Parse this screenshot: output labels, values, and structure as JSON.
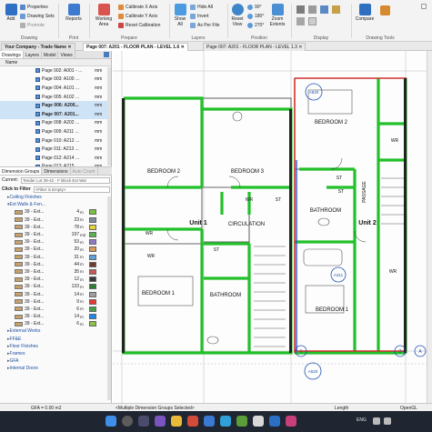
{
  "ribbon": {
    "drawing": {
      "add": "Add",
      "properties": "Properties",
      "drawing_sets": "Drawing Sets",
      "promote": "Promote",
      "label": "Drawing"
    },
    "print": {
      "reports": "Reports",
      "label": "Print"
    },
    "prepare": {
      "working_area": "Working Area",
      "calibrate_x": "Calibrate X Axis",
      "calibrate_y": "Calibrate Y Axis",
      "reset_calibration": "Reset Calibration",
      "label": "Prepare"
    },
    "layers": {
      "show_all": "Show All",
      "hide_all": "Hide All",
      "invert": "Invert",
      "as_per_file": "As Per File",
      "label": "Layers"
    },
    "position": {
      "reset_view": "Reset View",
      "rot90": "90°",
      "rot180": "180°",
      "rot270": "270°",
      "zoom_extents": "Zoom Extents",
      "label": "Position"
    },
    "display": {
      "label": "Display"
    },
    "drawing_tools": {
      "compare": "Compare",
      "label": "Drawing Tools"
    }
  },
  "tabs": {
    "company": "Your Company - Trade Name",
    "doc1": "Page 007: A201 - FLOOR PLAN - LEVEL 1.6",
    "doc2": "Page 007: A201 - FLOOR PLAN - LEVEL 1.3"
  },
  "left": {
    "tabs": [
      "Drawings",
      "Layers",
      "Model",
      "Views"
    ],
    "col_name": "Name",
    "pages": [
      {
        "name": "Page 002: A001 - ...",
        "unit": "mm",
        "sel": false
      },
      {
        "name": "Page 003: A100 ...",
        "unit": "mm",
        "sel": false
      },
      {
        "name": "Page 004: A101 ...",
        "unit": "mm",
        "sel": false
      },
      {
        "name": "Page 005: A102 ...",
        "unit": "mm",
        "sel": false
      },
      {
        "name": "Page 006: A200...",
        "unit": "mm",
        "sel": true
      },
      {
        "name": "Page 007: A201...",
        "unit": "mm",
        "sel": true
      },
      {
        "name": "Page 008: A202 ...",
        "unit": "mm",
        "sel": false
      },
      {
        "name": "Page 009: A211 ...",
        "unit": "mm",
        "sel": false
      },
      {
        "name": "Page 010: A212 ...",
        "unit": "mm",
        "sel": false
      },
      {
        "name": "Page 011: A213 ...",
        "unit": "mm",
        "sel": false
      },
      {
        "name": "Page 012: A214 ...",
        "unit": "mm",
        "sel": false
      },
      {
        "name": "Page 013: A215 ...",
        "unit": "mm",
        "sel": false
      },
      {
        "name": "Page 014: A216 ...",
        "unit": "mm",
        "sel": false
      }
    ],
    "dim_tabs": [
      "Dimension Groups",
      "Dimensions",
      "Auto Count"
    ],
    "current_label": "Current:",
    "current_value": "Tender Lot 39-42 - F Block Ext Wal",
    "filter_label": "Click to Filter",
    "filter_placeholder": "<Filter is Empty>",
    "tree_top": [
      "Ceiling Finishes",
      "Ext Walls & Fen..."
    ],
    "tree_rows": [
      {
        "name": "39 - Ext...",
        "value": "4",
        "unit": "m",
        "sw": "#c8a06a",
        "box": "#7cc242"
      },
      {
        "name": "39 - Ext...",
        "value": "23",
        "unit": "m",
        "sw": "#c8a06a",
        "box": "#7f8c9a"
      },
      {
        "name": "39 - Ext...",
        "value": "78",
        "unit": "m",
        "sw": "#c8a06a",
        "box": "#e6d23a"
      },
      {
        "name": "39 - Ext...",
        "value": "197",
        "unit": "m2",
        "sw": "#c8a06a",
        "box": "#59b34f"
      },
      {
        "name": "39 - Ext...",
        "value": "53",
        "unit": "m",
        "sw": "#c8a06a",
        "box": "#8f7cc8"
      },
      {
        "name": "39 - Ext...",
        "value": "20",
        "unit": "m",
        "sw": "#c8a06a",
        "box": "#d79b55"
      },
      {
        "name": "39 - Ext...",
        "value": "31",
        "unit": "m",
        "sw": "#c8a06a",
        "box": "#5fa0d8"
      },
      {
        "name": "39 - Ext...",
        "value": "44",
        "unit": "m",
        "sw": "#c8a06a",
        "box": "#6d3d2b"
      },
      {
        "name": "39 - Ext...",
        "value": "35",
        "unit": "m",
        "sw": "#c8a06a",
        "box": "#c65a5a"
      },
      {
        "name": "39 - Ext...",
        "value": "12",
        "unit": "m",
        "sw": "#c8a06a",
        "box": "#3a3a3a"
      },
      {
        "name": "39 - Ext...",
        "value": "133",
        "unit": "m",
        "sw": "#c8a06a",
        "box": "#2e7d32"
      },
      {
        "name": "39 - Ext...",
        "value": "14",
        "unit": "m",
        "sw": "#c8a06a",
        "box": "#9e9e9e"
      },
      {
        "name": "39 - Ext...",
        "value": "9",
        "unit": "m",
        "sw": "#c8a06a",
        "box": "#e53935"
      },
      {
        "name": "39 - Ext...",
        "value": "6",
        "unit": "m",
        "sw": "#c8a06a",
        "box": "#43a047"
      },
      {
        "name": "39 - Ext...",
        "value": "14",
        "unit": "m",
        "sw": "#c8a06a",
        "box": "#1e88e5"
      },
      {
        "name": "39 - Ext...",
        "value": "6",
        "unit": "m",
        "sw": "#c8a06a",
        "box": "#8bc34a"
      }
    ],
    "tree_bottom": [
      "External Works",
      "FF&E",
      "Floor Finishes",
      "Frames",
      "GFA",
      "Internal Doors"
    ]
  },
  "plan": {
    "labels": {
      "bedroom2_left": "BEDROOM 2",
      "bedroom3": "BEDROOM 3",
      "bedroom2_right": "BEDROOM 2",
      "bedroom1_left": "BEDROOM 1",
      "bedroom1_right": "BEDROOM 1",
      "unit1": "Unit 1",
      "unit2": "Unit 2",
      "circulation": "CIRCULATION",
      "bathroom_left": "BATHROOM",
      "bathroom_right": "BATHROOM",
      "passage": "PASSAGE",
      "wr1": "WR",
      "wr2": "WR",
      "wr3": "WR",
      "wr4": "WR",
      "wr5": "WR",
      "st1": "ST",
      "st2": "ST",
      "st3": "ST",
      "st4": "ST",
      "tag_a520_top": "A520",
      "tag_a520_bot": "A520",
      "tag_a311": "A311",
      "tag_1": "1",
      "tag_a": "A",
      "tag_2": "2"
    }
  },
  "status": {
    "gfa": "GFA = 0.00 m2",
    "groups": "<Multiple Dimension Groups Selected>",
    "length": "Length",
    "app": "OpenGL"
  },
  "taskbar": {
    "lang": "ENG",
    "time": "",
    "date": ""
  },
  "colors": {
    "green": "#22c02a",
    "red": "#d03030",
    "blue": "#3050c8"
  }
}
